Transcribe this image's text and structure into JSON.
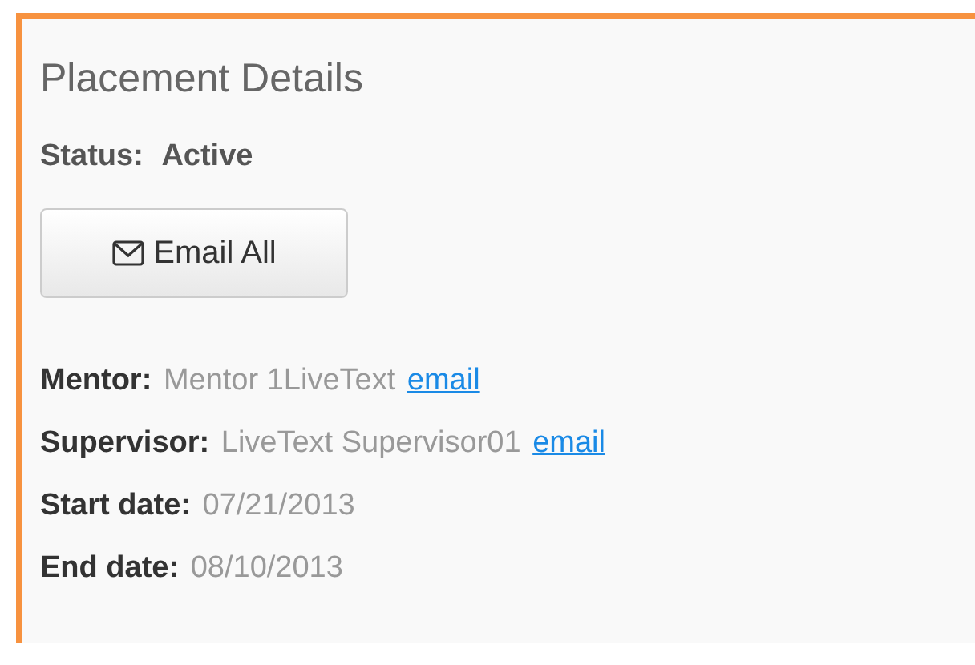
{
  "panel": {
    "title": "Placement Details"
  },
  "status": {
    "label": "Status:",
    "value": "Active"
  },
  "email_all_button": {
    "label": "Email All"
  },
  "details": [
    {
      "label": "Mentor:",
      "value": "Mentor 1LiveText",
      "link": "email"
    },
    {
      "label": "Supervisor:",
      "value": "LiveText Supervisor01",
      "link": "email"
    },
    {
      "label": "Start date:",
      "value": "07/21/2013"
    },
    {
      "label": "End date:",
      "value": "08/10/2013"
    }
  ]
}
